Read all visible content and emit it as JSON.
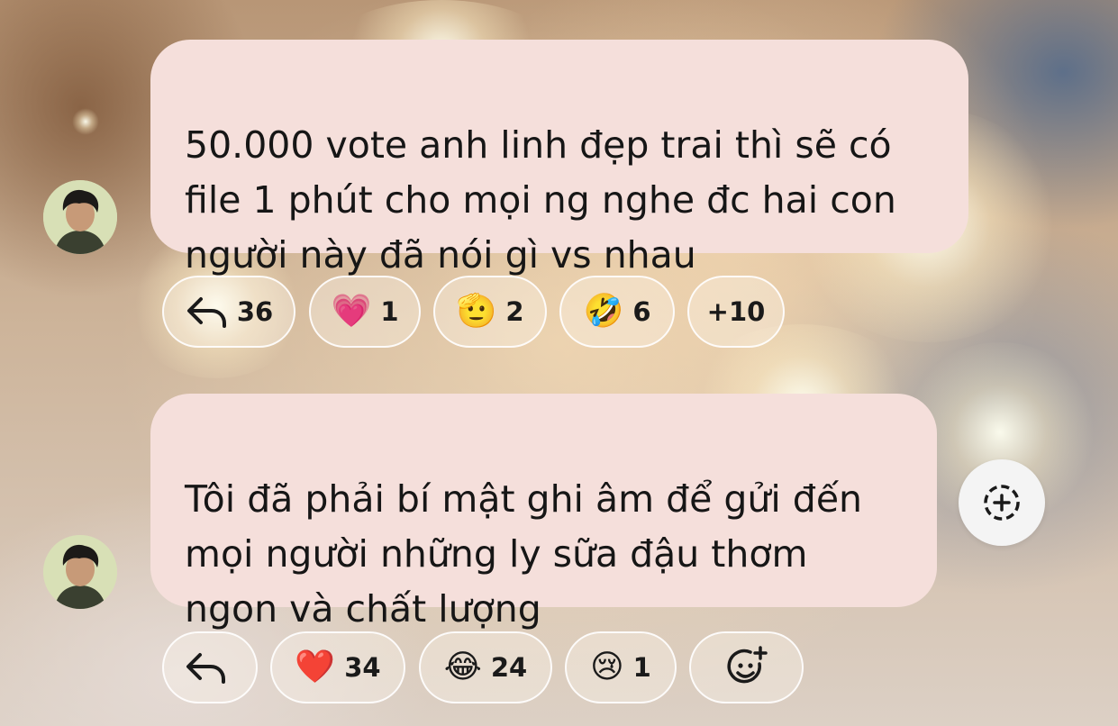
{
  "messages": [
    {
      "text": "50.000 vote anh linh đẹp trai thì sẽ có\nfile 1 phút cho mọi ng nghe đc hai con\nngười này đã nói gì vs nhau",
      "reactions": [
        {
          "icon": "reply-icon",
          "count": "36"
        },
        {
          "icon": "pink-heart-emoji",
          "glyph": "💗",
          "count": "1"
        },
        {
          "icon": "saluting-face-emoji",
          "glyph": "🫡",
          "count": "2"
        },
        {
          "icon": "rofl-emoji",
          "glyph": "🤣",
          "count": "6"
        },
        {
          "more": "+10"
        }
      ]
    },
    {
      "text": "Tôi đã phải bí mật ghi âm để gửi đến\nmọi người những ly sữa đậu thơm\nngon và chất lượng",
      "reactions": [
        {
          "icon": "reply-icon",
          "count": ""
        },
        {
          "icon": "red-heart-emoji",
          "glyph": "❤️",
          "count": "34"
        },
        {
          "icon": "tears-of-joy-emoji",
          "glyph": "😂",
          "count": "24"
        },
        {
          "icon": "crying-face-emoji",
          "glyph": "😢",
          "count": "1"
        },
        {
          "icon": "add-reaction-icon"
        }
      ]
    }
  ],
  "colors": {
    "bubble": "#f5dfdb",
    "text": "#161616",
    "pill_border": "#ffffff"
  }
}
